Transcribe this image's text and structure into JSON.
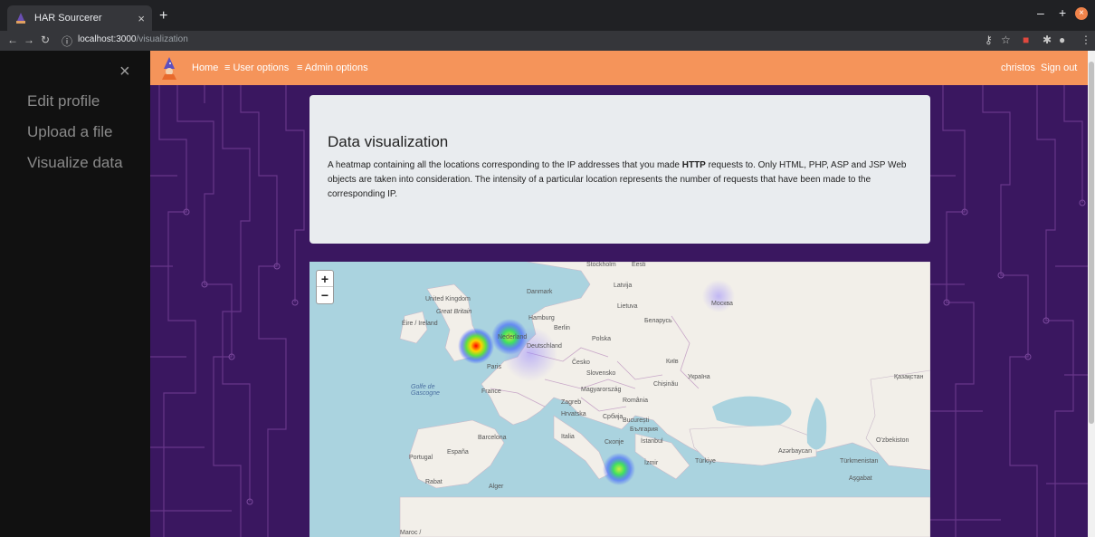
{
  "browser": {
    "tab_title": "HAR Sourcerer",
    "tab_close": "×",
    "new_tab": "+",
    "url_host": "localhost:3000",
    "url_path": "/visualization"
  },
  "sidebar": {
    "close": "×",
    "items": [
      {
        "label": "Edit profile"
      },
      {
        "label": "Upload a file"
      },
      {
        "label": "Visualize data"
      }
    ]
  },
  "navbar": {
    "home": "Home",
    "user_options": "≡ User options",
    "admin_options": "≡ Admin options",
    "username": "christos",
    "sign_out": "Sign out",
    "bg_color": "#f5945a"
  },
  "card": {
    "title": "Data visualization",
    "text_before": "A heatmap containing all the locations corresponding to the IP addresses that you made ",
    "text_bold": "HTTP",
    "text_after": " requests to. Only HTML, PHP, ASP and JSP Web objects are taken into consideration. The intensity of a particular location represents the number of requests that have been made to the corresponding IP."
  },
  "map": {
    "zoom_in": "+",
    "zoom_out": "−",
    "labels": {
      "united_kingdom": "United Kingdom",
      "great_britain": "Great Britain",
      "eire": "Éire / Ireland",
      "danmark": "Danmark",
      "hamburg": "Hamburg",
      "berlin": "Berlin",
      "nederland": "Nederland",
      "deutschland": "Deutschland",
      "polska": "Polska",
      "latvija": "Latvija",
      "lietuva": "Lietuva",
      "belarus": "Беларусь",
      "moskva": "Москва",
      "kyiv": "Київ",
      "ukraina": "Україна",
      "kazakhstan": "Қазақстан",
      "paris": "Paris",
      "france": "France",
      "cesko": "Česko",
      "slovensko": "Slovensko",
      "magyarorszag": "Magyarország",
      "chisinau": "Chișinău",
      "romania": "România",
      "zagreb": "Zagreb",
      "hrvatska": "Hrvatska",
      "srbija": "Србија",
      "bucuresti": "București",
      "bulgaria": "България",
      "italia": "Italia",
      "skopje": "Скопје",
      "istanbul": "İstanbul",
      "izmir": "İzmir",
      "turkiye": "Türkiye",
      "barcelona": "Barcelona",
      "espana": "España",
      "portugal": "Portugal",
      "alger": "Alger",
      "rabat": "Rabat",
      "maroc": "Maroc /",
      "ozbekiston": "O'zbekiston",
      "turkmenistan": "Türkmenistan",
      "asgabat": "Aşgabat",
      "azerbaijan": "Azərbaycan",
      "golfe": "Golfe de Gascogne",
      "eesti": "Eesti",
      "stockholm": "Stockholm"
    },
    "hotspots": [
      {
        "place": "London",
        "intensity": 1.0
      },
      {
        "place": "Amsterdam",
        "intensity": 0.65
      },
      {
        "place": "Athens",
        "intensity": 0.75
      },
      {
        "place": "Frankfurt",
        "intensity": 0.2
      },
      {
        "place": "Moscow",
        "intensity": 0.15
      }
    ]
  }
}
